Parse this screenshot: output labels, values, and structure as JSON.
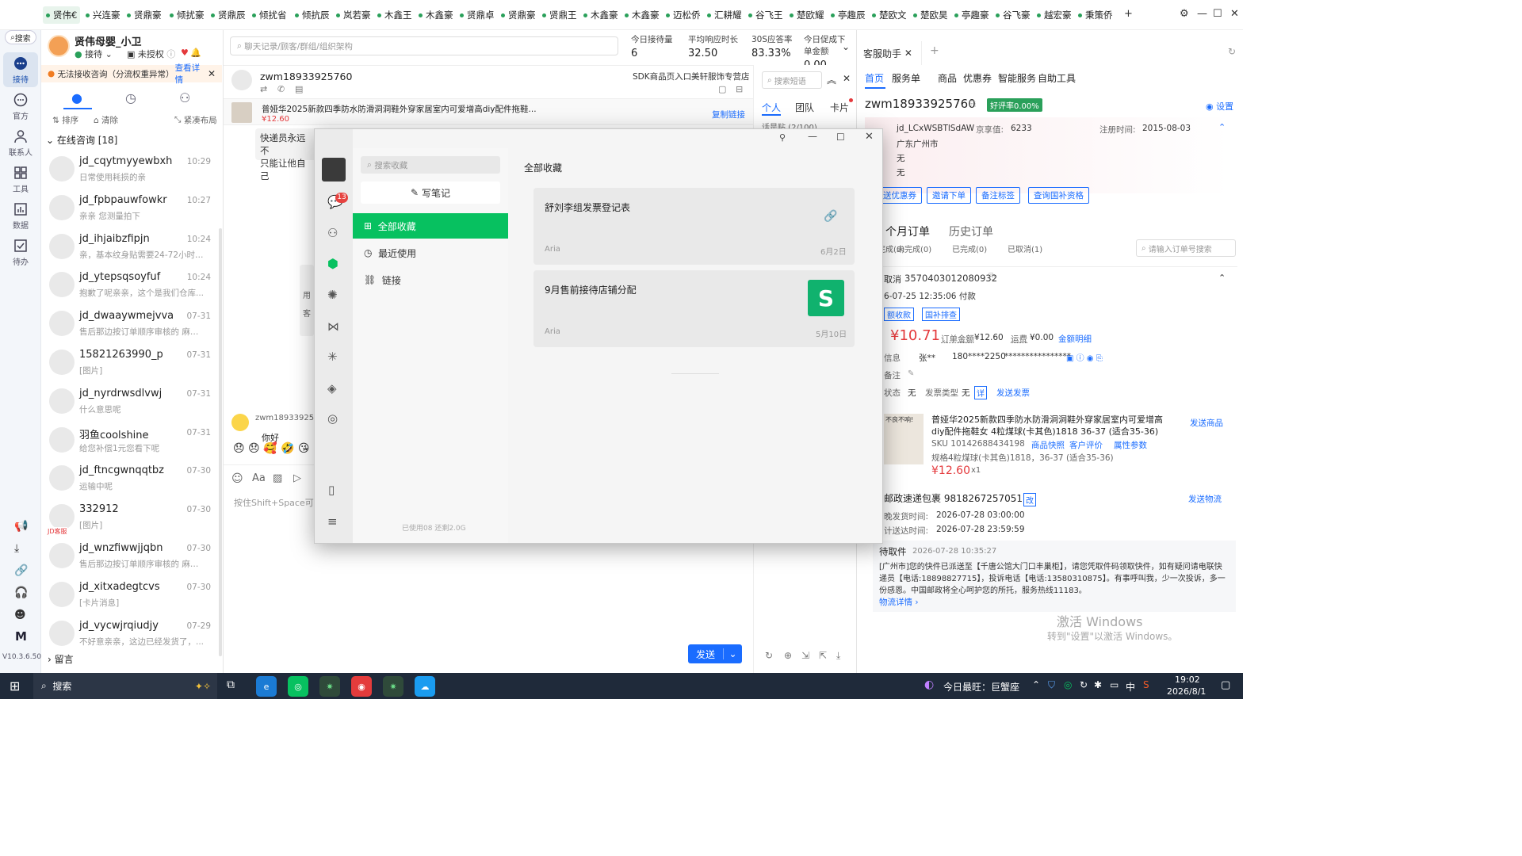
{
  "tabs": [
    "贤伟€",
    "兴连豪",
    "贤鼎豪",
    "倾扰豪",
    "贤鼎辰",
    "倾扰省",
    "倾抗辰",
    "岚若豪",
    "木鑫王",
    "木鑫豪",
    "贤鼎卓",
    "贤鼎豪",
    "贤鼎王",
    "木鑫豪",
    "木鑫豪",
    "迈松侨",
    "汇耕耀",
    "谷飞王",
    "楚欧耀",
    "亭趣辰",
    "楚欧文",
    "楚欧昊",
    "亭趣豪",
    "谷飞豪",
    "越宏豪",
    "秉策侨"
  ],
  "rail": {
    "search": "搜索",
    "items": [
      "接待",
      "官方",
      "联系人",
      "工具",
      "数据",
      "待办"
    ],
    "version": "V10.3.6.500",
    "m_label": "M"
  },
  "profile": {
    "shop": "贤伟母婴_小卫",
    "status": "接待",
    "auth": "未授权"
  },
  "alert": {
    "text": "无法接收咨询（分流权重异常）",
    "link": "查看详情"
  },
  "list_tools": {
    "sort": "排序",
    "clear": "清除",
    "layout": "紧凑布局"
  },
  "online_header": "在线咨询 [18]",
  "conversations": [
    {
      "name": "jd_cqytmyyewbxh",
      "time": "10:29",
      "preview": "日常使用耗损的亲"
    },
    {
      "name": "jd_fpbpauwfowkr",
      "time": "10:27",
      "preview": "亲亲 您测量拍下"
    },
    {
      "name": "jd_ihjaibzfipjn",
      "time": "10:24",
      "preview": "亲，基本纹身贴需要24-72小时才..."
    },
    {
      "name": "jd_ytepsqsoyfuf",
      "time": "10:24",
      "preview": "抱歉了呢亲亲，这个是我们仓库..."
    },
    {
      "name": "jd_dwaaywmejvva",
      "time": "07-31",
      "preview": "售后那边按订单顺序审核的 麻烦..."
    },
    {
      "name": "15821263990_p",
      "time": "07-31",
      "preview": "[图片]"
    },
    {
      "name": "jd_nyrdrwsdlvwj",
      "time": "07-31",
      "preview": "什么意思呢"
    },
    {
      "name": "羽鱼coolshine",
      "time": "07-31",
      "preview": "给您补偿1元您看下呢"
    },
    {
      "name": "jd_ftncgwnqqtbz",
      "time": "07-30",
      "preview": "运输中呢"
    },
    {
      "name": "332912",
      "time": "07-30",
      "preview": "[图片]"
    },
    {
      "name": "jd_wnzfiwwjjqbn",
      "time": "07-30",
      "preview": "售后那边按订单顺序审核的 麻烦..."
    },
    {
      "name": "jd_xitxadegtcvs",
      "time": "07-30",
      "preview": "[卡片消息]"
    },
    {
      "name": "jd_vycwjrqiudjy",
      "time": "07-29",
      "preview": "不好意亲亲，这边已经发货了，..."
    }
  ],
  "jd_badge": "JD客服",
  "leave_msg": "留言",
  "search_bar": {
    "placeholder": "聊天记录/顾客/群组/组织架构"
  },
  "stats": [
    {
      "label": "今日接待量",
      "value": "6"
    },
    {
      "label": "平均响应时长",
      "value": "32.50"
    },
    {
      "label": "30S应答率",
      "value": "83.33%"
    },
    {
      "label": "今日促成下单金额",
      "value": "0.00"
    }
  ],
  "chat_header": {
    "user": "zwm18933925760",
    "sdk": "SDK商品页入口",
    "store": "美轩服饰专营店"
  },
  "product_banner": {
    "title": "普娅华2025新款四季防水防滑洞洞鞋外穿家居室内可爱增高diy配件拖鞋...",
    "price": "¥12.60",
    "copy": "复制链接"
  },
  "chat_msgs": {
    "m1": "快递员永远不",
    "m2": "只能让他自己",
    "partial1": "用",
    "partial2": "客",
    "sender": "zwm18933925760",
    "hello": "你好"
  },
  "input_hint": "按住Shift+Space可",
  "send_btn": "发送",
  "side_mid": {
    "search": "搜索短语",
    "tabs": [
      "个人",
      "团队",
      "卡片"
    ],
    "section": "话是贴 (2/100)"
  },
  "right": {
    "title": "客服助手",
    "nav": [
      "首页",
      "服务单",
      "商品",
      "优惠券",
      "智能服务",
      "自助工具"
    ],
    "user": "zwm18933925760",
    "rating": "好评率0.00%",
    "settings": "设置",
    "user_id": "jd_LCxWSBTlSdAW",
    "jing_label": "京享值:",
    "jing_val": "6233",
    "reg_label": "注册时间:",
    "reg_val": "2015-08-03",
    "region": "广东广州市",
    "line_none1": "无",
    "line_none2": "无",
    "btns": [
      "送优惠券",
      "邀请下单",
      "备注标签",
      "查询国补资格"
    ],
    "order_tabs": [
      "个月订单",
      "历史订单"
    ],
    "order_filters": [
      "完成(0)",
      "未完成(0)",
      "已完成(0)",
      "已取消(1)"
    ],
    "order_search": "请输入订单号搜索",
    "order_status": "取消",
    "order_no": "3570403012080932",
    "order_time": "6-07-25 12:35:06 付款",
    "tag1": "额收款",
    "tag2": "国补排查",
    "amount": "¥10.71",
    "order_amt_label": "订单金额",
    "order_amt": "¥12.60",
    "freight_label": "运费",
    "freight": "¥0.00",
    "amt_detail": "金额明细",
    "recv_label": "信息",
    "recv_name": "张**",
    "recv_phone": "180****2250",
    "recv_addr": "****************",
    "remark_label": "备注",
    "inv_label": "状态",
    "inv_state": "无",
    "inv_type_label": "发票类型",
    "inv_type": "无",
    "inv_detail": "详",
    "inv_send": "发送发票",
    "goods_title": "普娅华2025新款四季防水防滑洞洞鞋外穿家居室内可爱增高diy配件拖鞋女 4粒煤球(卡其色)1818 36-37 (适合35-36)",
    "send_goods": "发送商品",
    "sku": "SKU 10142688434198",
    "snapshot": "商品快照",
    "review": "客户评价",
    "attr": "属性参数",
    "spec": "规格4粒煤球(卡其色)1818，36-37 (适合35-36)",
    "goods_price": "¥12.60",
    "qty": "x1",
    "thumb_label": "不良不响!",
    "express": "邮政速递包裹 9818267257051",
    "express_change": "改",
    "send_logistics": "发送物流",
    "ship_label": "晚发货时间:",
    "ship_time": "2026-07-28 03:00:00",
    "arrive_label": "计送达时间:",
    "arrive_time": "2026-07-28 23:59:59",
    "pickup": "待取件",
    "pickup_time": "2026-07-28 10:35:27",
    "pickup_text": "[广州市]您的快件已派送至【千唐公馆大门口丰巢柜】，请您凭取件码领取快件，如有疑问请电联快递员【电话:18898827715】，投诉电话【电话:13580310875】。有事呼叫我，少一次投诉，多一份感恩。中国邮政将全心呵护您的所托，服务热线11183。",
    "logistics_detail": "物流详情"
  },
  "overlay": {
    "search": "搜索收藏",
    "write": "写笔记",
    "badge": "13",
    "nav": [
      "全部收藏",
      "最近使用",
      "链接"
    ],
    "storage": "已使用08 还剩2.0G",
    "heading": "全部收藏",
    "cards": [
      {
        "title": "舒刘李组发票登记表",
        "author": "Aria",
        "date": "6月2日"
      },
      {
        "title": "9月售前接待店铺分配",
        "author": "Aria",
        "date": "5月10日"
      }
    ]
  },
  "watermark": {
    "line1": "激活 Windows",
    "line2": "转到\"设置\"以激活 Windows。"
  },
  "taskbar": {
    "search": "搜索",
    "news": "今日最旺：巨蟹座",
    "ime": "中",
    "time": "19:02",
    "date": "2026/8/1"
  },
  "colors": {
    "accent_green": "#2aa05a",
    "jd_blue": "#1a6cff",
    "jd_red": "#e4393c",
    "wechat_green": "#07c160"
  }
}
